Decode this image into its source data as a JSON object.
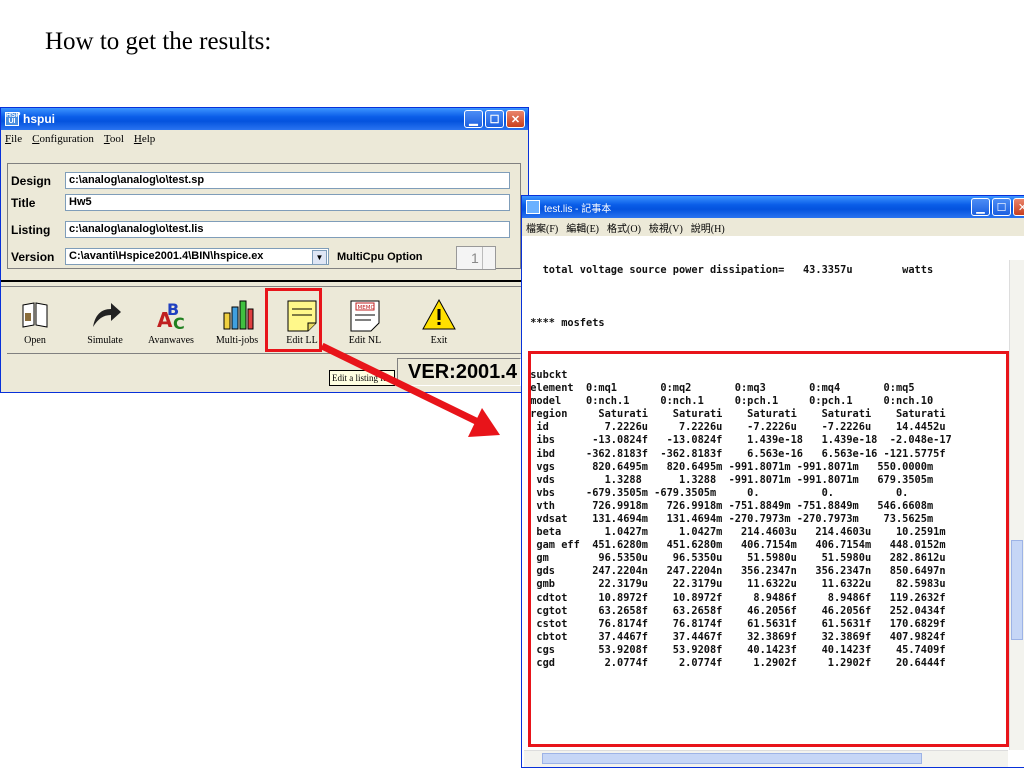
{
  "slide": {
    "title": "How to get the results:"
  },
  "hspui": {
    "title": "hspui",
    "menu": [
      "File",
      "Configuration",
      "Tool",
      "Help"
    ],
    "fields": {
      "design_label": "Design",
      "design_value": "c:\\analog\\analog\\o\\test.sp",
      "title_label": "Title",
      "title_value": "Hw5",
      "listing_label": "Listing",
      "listing_value": "c:\\analog\\analog\\o\\test.lis",
      "version_label": "Version",
      "version_value": "C:\\avanti\\Hspice2001.4\\BIN\\hspice.ex",
      "multicpu_label": "MultiCpu Option",
      "multicpu_value": "1"
    },
    "tools": [
      {
        "label": "Open"
      },
      {
        "label": "Simulate"
      },
      {
        "label": "Avanwaves"
      },
      {
        "label": "Multi-jobs"
      },
      {
        "label": "Edit LL"
      },
      {
        "label": "Edit NL"
      },
      {
        "label": "Exit"
      }
    ],
    "editnl_icon_text": "MEMO",
    "tooltip": "Edit a listing file",
    "version_display": "VER:2001.4"
  },
  "notepad": {
    "title": "test.lis - 記事本",
    "menu": [
      "檔案(F)",
      "編輯(E)",
      "格式(O)",
      "檢視(V)",
      "說明(H)"
    ],
    "text": "\n\n   total voltage source power dissipation=   43.3357u        watts\n\n\n\n **** mosfets\n\n\n\n subckt\n element  0:mq1       0:mq2       0:mq3       0:mq4       0:mq5\n model    0:nch.1     0:nch.1     0:pch.1     0:pch.1     0:nch.10\n region     Saturati    Saturati    Saturati    Saturati    Saturati\n  id         7.2226u     7.2226u    -7.2226u    -7.2226u    14.4452u\n  ibs      -13.0824f   -13.0824f    1.439e-18   1.439e-18  -2.048e-17\n  ibd     -362.8183f  -362.8183f    6.563e-16   6.563e-16 -121.5775f\n  vgs      820.6495m   820.6495m -991.8071m -991.8071m   550.0000m\n  vds        1.3288      1.3288  -991.8071m -991.8071m   679.3505m\n  vbs     -679.3505m -679.3505m     0.          0.          0.\n  vth      726.9918m   726.9918m -751.8849m -751.8849m   546.6608m\n  vdsat    131.4694m   131.4694m -270.7973m -270.7973m    73.5625m\n  beta       1.0427m     1.0427m   214.4603u   214.4603u    10.2591m\n  gam eff  451.6280m   451.6280m   406.7154m   406.7154m   448.0152m\n  gm        96.5350u    96.5350u    51.5980u    51.5980u   282.8612u\n  gds      247.2204n   247.2204n   356.2347n   356.2347n   850.6497n\n  gmb       22.3179u    22.3179u    11.6322u    11.6322u    82.5983u\n  cdtot     10.8972f    10.8972f     8.9486f     8.9486f   119.2632f\n  cgtot     63.2658f    63.2658f    46.2056f    46.2056f   252.0434f\n  cstot     76.8174f    76.8174f    61.5631f    61.5631f   170.6829f\n  cbtot     37.4467f    37.4467f    32.3869f    32.3869f   407.9824f\n  cgs       53.9208f    53.9208f    40.1423f    40.1423f    45.7409f\n  cgd        2.0774f     2.0774f     1.2902f     1.2902f    20.6444f"
  },
  "colors": {
    "highlight": "#e8141a",
    "xp_blue": "#0a5de8"
  }
}
